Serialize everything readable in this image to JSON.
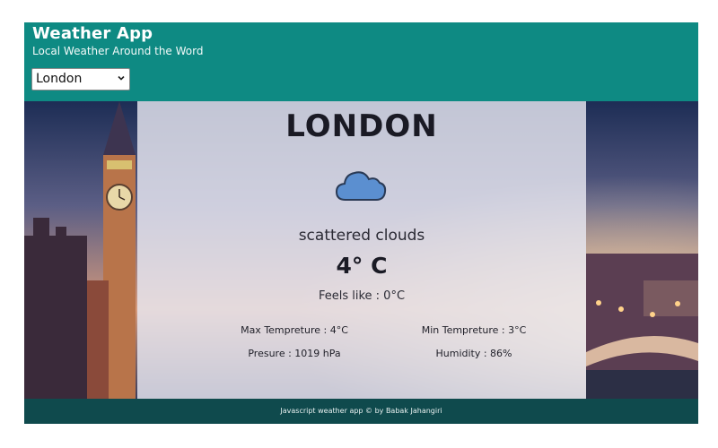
{
  "header": {
    "title": "Weather App",
    "subtitle": "Local Weather Around the Word",
    "city_select": {
      "selected": "London",
      "options": [
        "London"
      ]
    }
  },
  "weather": {
    "city": "LONDON",
    "icon": "cloud-icon",
    "description": "scattered clouds",
    "temperature": "4° C",
    "feels_like": "Feels like : 0°C",
    "max_temp": "Max Tempreture : 4°C",
    "min_temp": "Min Tempreture : 3°C",
    "pressure": "Presure : 1019 hPa",
    "humidity": "Humidity : 86%"
  },
  "footer": {
    "text": "Javascript weather app © by Babak Jahangiri"
  },
  "colors": {
    "header_bg": "#0e8a83",
    "footer_bg": "#0f4a4d",
    "panel_bg": "#e8e8f2",
    "cloud": "#5b8fd0"
  }
}
